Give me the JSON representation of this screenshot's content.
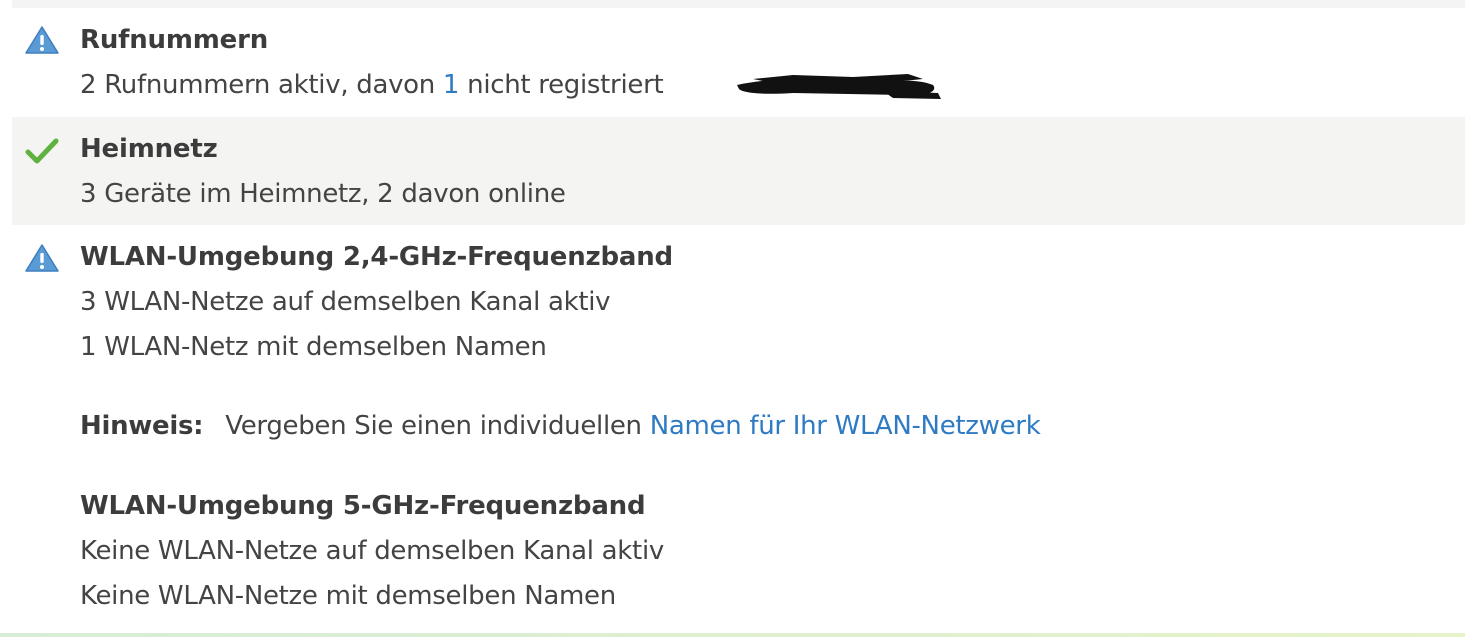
{
  "items": [
    {
      "status": "warning",
      "icon": "warning-icon",
      "title": "Rufnummern",
      "line_prefix": "2 Rufnummern aktiv, davon ",
      "line_link": "1",
      "line_suffix": " nicht registriert"
    },
    {
      "status": "ok",
      "icon": "check-icon",
      "title": "Heimnetz",
      "line": "3 Geräte im Heimnetz, 2 davon online"
    },
    {
      "status": "warning",
      "icon": "warning-icon",
      "title": "WLAN-Umgebung 2,4-GHz-Frequenzband",
      "lines": [
        "3 WLAN-Netze auf demselben Kanal aktiv",
        "1 WLAN-Netz mit demselben Namen"
      ],
      "hint": {
        "label": "Hinweis:",
        "text": "Vergeben Sie einen individuellen ",
        "link": "Namen für Ihr WLAN-Netzwerk"
      },
      "sub_title": "WLAN-Umgebung 5-GHz-Frequenzband",
      "sub_lines": [
        "Keine WLAN-Netze auf demselben Kanal aktiv",
        "Keine WLAN-Netze mit demselben Namen"
      ]
    }
  ],
  "colors": {
    "warning_icon": "#5b9bd5",
    "check_icon": "#5fb23f",
    "link": "#2e7bc4",
    "alt_row_bg": "#f4f4f2"
  }
}
